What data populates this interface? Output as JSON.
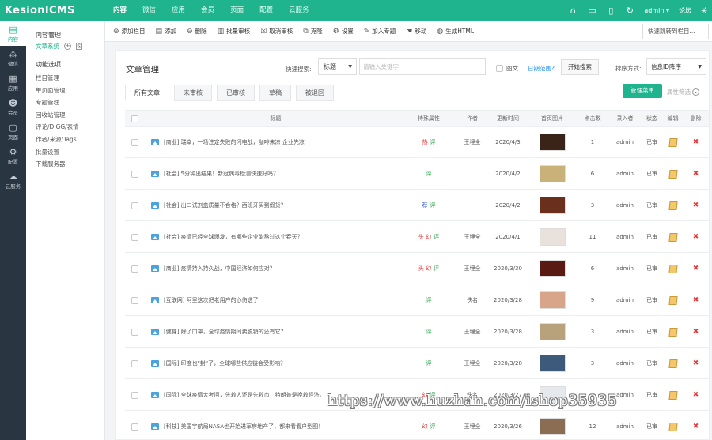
{
  "app": {
    "logo": "KesionICMS",
    "top_nav": [
      "内容",
      "微信",
      "应用",
      "会员",
      "页面",
      "配置",
      "云服务"
    ],
    "active_nav_index": 0,
    "user": "admin ▾",
    "forum": "论坛",
    "truncated": "关"
  },
  "iconbar": [
    {
      "label": "内容",
      "icon": "content-icon",
      "active": true
    },
    {
      "label": "微信",
      "icon": "wechat-icon",
      "active": false
    },
    {
      "label": "应用",
      "icon": "apps-icon",
      "active": false
    },
    {
      "label": "会员",
      "icon": "members-icon",
      "active": false
    },
    {
      "label": "页面",
      "icon": "page-icon",
      "active": false
    },
    {
      "label": "配置",
      "icon": "gear-icon",
      "active": false
    },
    {
      "label": "云服务",
      "icon": "cloud-icon",
      "active": false
    }
  ],
  "subnav": {
    "header": "内容管理",
    "active_item": "文章系统",
    "section": "功能选项",
    "items": [
      "栏目管理",
      "单页面管理",
      "专题管理",
      "回收站管理",
      "评论/DIGG/表情",
      "作者/来源/Tags",
      "批量设置",
      "下载服务器"
    ]
  },
  "toolbar": {
    "buttons": [
      {
        "label": "添加栏目",
        "icon": "add-circle-icon"
      },
      {
        "label": "添加",
        "icon": "document-add-icon"
      },
      {
        "label": "删除",
        "icon": "remove-circle-icon"
      },
      {
        "label": "批量审核",
        "icon": "batch-review-icon"
      },
      {
        "label": "取消审核",
        "icon": "cancel-review-icon"
      },
      {
        "label": "克隆",
        "icon": "clone-icon"
      },
      {
        "label": "设置",
        "icon": "settings-icon"
      },
      {
        "label": "加入专题",
        "icon": "pencil-icon"
      },
      {
        "label": "移动",
        "icon": "hand-icon"
      },
      {
        "label": "生成HTML",
        "icon": "globe-icon"
      }
    ],
    "jump": "快速跳转到栏目..."
  },
  "panel": {
    "title": "文章管理",
    "quick_search_label": "快速搜索:",
    "quick_search_value": "标题",
    "keyword_placeholder": "请输入关键字",
    "tuwen_label": "图文",
    "date_range": "日期范围?",
    "search_button": "开始搜索",
    "sort_label": "排序方式:",
    "sort_value": "信息ID降序",
    "tabs": [
      "所有文章",
      "未审核",
      "已审核",
      "草稿",
      "被退回"
    ],
    "active_tab": 0,
    "manage_menu": "管理菜单",
    "attr_filter": "属性筛选"
  },
  "table": {
    "headers": [
      "标题",
      "特殊属性",
      "作者",
      "更新时间",
      "首页图片",
      "点击数",
      "录入者",
      "状态",
      "编辑",
      "删除"
    ],
    "rows": [
      {
        "title": "[商业] 瑞幸，一场注定失败的闪电战，咖啡未凉 企业先凉",
        "attr_a": "热",
        "attr_b": "评",
        "author": "王埋全",
        "date": "2020/4/3",
        "thumb_color": "#3a2418",
        "hits": "1",
        "editor": "admin",
        "status": "已审"
      },
      {
        "title": "[社会] 5分钟出结果！新冠病毒检测快速好吗？",
        "attr_a": "",
        "attr_b": "评",
        "author": "",
        "date": "2020/4/2",
        "thumb_color": "#c9b27a",
        "hits": "6",
        "editor": "admin",
        "status": "已审"
      },
      {
        "title": "[社会] 出口试剂盒质量不合格？西班牙买到假货？",
        "attr_a": "荐",
        "attr_b": "评",
        "author": "",
        "date": "2020/4/2",
        "thumb_color": "#6b2f1e",
        "hits": "3",
        "editor": "admin",
        "status": "已审"
      },
      {
        "title": "[社会] 疫情已经全球爆发，有哪些企业能熬过这个春天？",
        "attr_a": "头 幻",
        "attr_b": "评",
        "author": "王埋全",
        "date": "2020/4/1",
        "thumb_color": "#e9e2dc",
        "hits": "11",
        "editor": "admin",
        "status": "已审"
      },
      {
        "title": "[商业] 疫情持入持久战，中国经济如何应对？",
        "attr_a": "头 幻",
        "attr_b": "评",
        "author": "王埋全",
        "date": "2020/3/30",
        "thumb_color": "#5a1a14",
        "hits": "6",
        "editor": "admin",
        "status": "已审"
      },
      {
        "title": "[互联网] 阿里这次把老用户的心伤透了",
        "attr_a": "",
        "attr_b": "评",
        "author": "佚名",
        "date": "2020/3/28",
        "thumb_color": "#d7a58a",
        "hits": "9",
        "editor": "admin",
        "status": "已审"
      },
      {
        "title": "[健身] 除了口罩，全球疫情期间卖脱销的还有它？",
        "attr_a": "",
        "attr_b": "评",
        "author": "王埋全",
        "date": "2020/3/28",
        "thumb_color": "#b8a27c",
        "hits": "3",
        "editor": "admin",
        "status": "已审"
      },
      {
        "title": "[国际] 印度也\"封\"了，全球哪些供应链会受影响？",
        "attr_a": "",
        "attr_b": "评",
        "author": "王埋全",
        "date": "2020/3/28",
        "thumb_color": "#3d5a7a",
        "hits": "3",
        "editor": "admin",
        "status": "已审"
      },
      {
        "title": "[国际] 全球疫情大考问，先救人还是先救市，特朗普是挽救经济。",
        "attr_a": "幻",
        "attr_b": "评",
        "author": "佚名",
        "date": "2020/3/27",
        "thumb_color": "#e5e8ec",
        "hits": "7",
        "editor": "admin",
        "status": "已审"
      },
      {
        "title": "[科技] 美国宇航局NASA也开始进军房地产了，都来看看户型图！",
        "attr_a": "幻",
        "attr_b": "评",
        "author": "王埋全",
        "date": "2020/3/26",
        "thumb_color": "#8a6d52",
        "hits": "12",
        "editor": "admin",
        "status": "已审"
      }
    ]
  },
  "watermark": "https://www.huzhan.com/ishop35935"
}
